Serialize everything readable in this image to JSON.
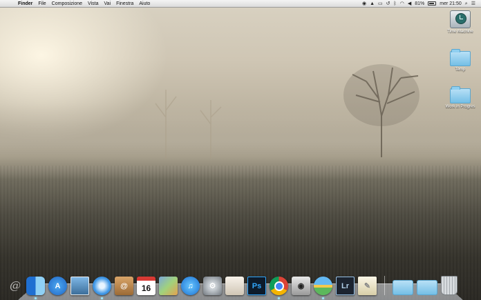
{
  "menubar": {
    "app_name": "Finder",
    "items": [
      "File",
      "Composizione",
      "Vista",
      "Vai",
      "Finestra",
      "Aiuto"
    ],
    "battery_percent": "81%",
    "clock": "mer 21:50",
    "status_icons": [
      "eye-icon",
      "bell-icon",
      "clipboard-icon",
      "timemachine-icon",
      "bluetooth-icon",
      "wifi-icon",
      "volume-icon",
      "battery-icon",
      "spotlight-icon",
      "notification-center-icon"
    ]
  },
  "desktop": {
    "icons": [
      {
        "label": "Time Machine",
        "icon": "time-machine-disk-icon"
      },
      {
        "label": "Temp",
        "icon": "folder-icon"
      },
      {
        "label": "Work in Progres",
        "icon": "folder-icon"
      }
    ]
  },
  "dock": {
    "apps": [
      {
        "name": "finder",
        "glyph": "",
        "icon": "finder-icon",
        "running": true
      },
      {
        "name": "app-store",
        "glyph": "A",
        "icon": "app-store-icon",
        "running": false
      },
      {
        "name": "preview",
        "glyph": "",
        "icon": "preview-icon",
        "running": false
      },
      {
        "name": "safari",
        "glyph": "",
        "icon": "safari-icon",
        "running": true
      },
      {
        "name": "contacts",
        "glyph": "@",
        "icon": "contacts-icon",
        "running": false
      },
      {
        "name": "calendar",
        "glyph": "16",
        "icon": "calendar-icon",
        "running": false
      },
      {
        "name": "photo-app",
        "glyph": "",
        "icon": "photo-icon",
        "running": false
      },
      {
        "name": "itunes",
        "glyph": "♫",
        "icon": "itunes-icon",
        "running": false
      },
      {
        "name": "system-preferences",
        "glyph": "⚙",
        "icon": "system-preferences-icon",
        "running": false
      },
      {
        "name": "ibooks",
        "glyph": "",
        "icon": "ibooks-icon",
        "running": false
      },
      {
        "name": "photoshop",
        "glyph": "Ps",
        "icon": "photoshop-icon",
        "running": false
      },
      {
        "name": "chrome",
        "glyph": "",
        "icon": "chrome-icon",
        "running": true
      },
      {
        "name": "screenshot",
        "glyph": "◉",
        "icon": "camera-icon",
        "running": false
      },
      {
        "name": "maps",
        "glyph": "",
        "icon": "maps-icon",
        "running": true
      },
      {
        "name": "lightroom",
        "glyph": "Lr",
        "icon": "lightroom-icon",
        "running": false
      },
      {
        "name": "textedit",
        "glyph": "✎",
        "icon": "textedit-icon",
        "running": false
      }
    ],
    "stacks": [
      "downloads-folder-icon",
      "documents-folder-icon"
    ],
    "trash": "trash-icon"
  }
}
